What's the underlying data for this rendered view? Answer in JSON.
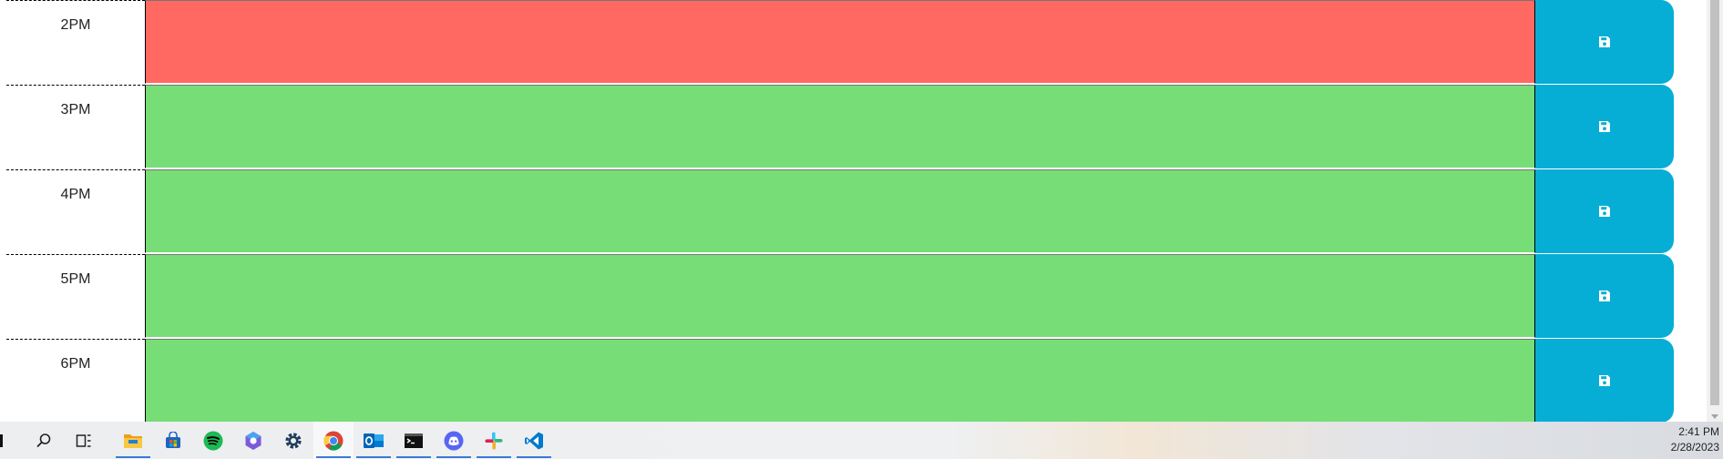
{
  "scheduler": {
    "rows": [
      {
        "hour": "2PM",
        "text": "",
        "state": "present"
      },
      {
        "hour": "3PM",
        "text": "",
        "state": "future"
      },
      {
        "hour": "4PM",
        "text": "",
        "state": "future"
      },
      {
        "hour": "5PM",
        "text": "",
        "state": "future"
      },
      {
        "hour": "6PM",
        "text": "",
        "state": "future"
      }
    ],
    "save_icon": "floppy-disk-icon",
    "colors": {
      "present": "#ff6961",
      "future": "#77dd77",
      "save_button": "#06aed5"
    }
  },
  "taskbar": {
    "apps": [
      {
        "name": "search-icon"
      },
      {
        "name": "task-view-icon"
      },
      {
        "name": "file-explorer-icon",
        "active": true
      },
      {
        "name": "microsoft-store-icon"
      },
      {
        "name": "spotify-icon"
      },
      {
        "name": "copilot-icon"
      },
      {
        "name": "settings-gear-icon"
      },
      {
        "name": "chrome-icon",
        "active": true,
        "selected": true
      },
      {
        "name": "outlook-icon",
        "active": true
      },
      {
        "name": "terminal-icon",
        "active": true
      },
      {
        "name": "discord-icon",
        "active": true
      },
      {
        "name": "slack-icon",
        "active": true
      },
      {
        "name": "vscode-icon",
        "active": true
      }
    ],
    "clock": {
      "time": "2:41 PM",
      "date": "2/28/2023"
    }
  }
}
